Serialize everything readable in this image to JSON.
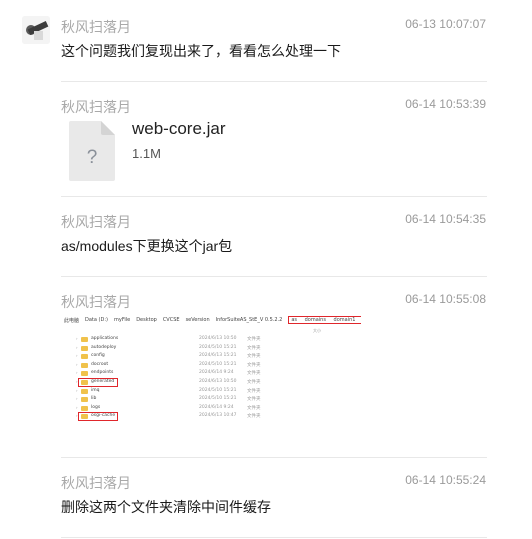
{
  "messages": [
    {
      "sender": "秋风扫落月",
      "time": "06-13 10:07:07",
      "text": "这个问题我们复现出来了，看看怎么处理一下"
    },
    {
      "sender": "秋风扫落月",
      "time": "06-14 10:53:39",
      "file": {
        "name": "web-core.jar",
        "size": "1.1M",
        "icon": "unknown-file-icon",
        "glyph": "?"
      }
    },
    {
      "sender": "秋风扫落月",
      "time": "06-14 10:54:35",
      "text": "as/modules下更换这个jar包"
    },
    {
      "sender": "秋风扫落月",
      "time": "06-14 10:55:08",
      "image": {
        "breadcrumbs": [
          "此电脑",
          "Data (D:)",
          "myFile",
          "Desktop",
          "CVCSE",
          "seVersion",
          "InforSuiteAS_StE_V 0.5.2.2"
        ],
        "highlighted_path": [
          "as",
          "domains",
          "domain1"
        ],
        "col_hint": "大小",
        "rows": [
          {
            "name": "applications",
            "date": "2024/6/13 10:50",
            "type": "文件夹",
            "highlight": false
          },
          {
            "name": "autodeploy",
            "date": "2024/5/10 15:21",
            "type": "文件夹",
            "highlight": false
          },
          {
            "name": "config",
            "date": "2024/6/13 15:21",
            "type": "文件夹",
            "highlight": false
          },
          {
            "name": "docroot",
            "date": "2024/5/10 15:21",
            "type": "文件夹",
            "highlight": false
          },
          {
            "name": "endpoints",
            "date": "2024/6/14 9:24",
            "type": "文件夹",
            "highlight": false
          },
          {
            "name": "generated",
            "date": "2024/6/13 10:50",
            "type": "文件夹",
            "highlight": true
          },
          {
            "name": "imq",
            "date": "2024/5/10 15:21",
            "type": "文件夹",
            "highlight": false
          },
          {
            "name": "lib",
            "date": "2024/5/10 15:21",
            "type": "文件夹",
            "highlight": false
          },
          {
            "name": "logs",
            "date": "2024/6/14 9:24",
            "type": "文件夹",
            "highlight": false
          },
          {
            "name": "osgi-cache",
            "date": "2024/6/13 10:47",
            "type": "文件夹",
            "highlight": true
          }
        ]
      }
    },
    {
      "sender": "秋风扫落月",
      "time": "06-14 10:55:24",
      "text": "删除这两个文件夹清除中间件缓存"
    }
  ],
  "colors": {
    "sender": "#a9a9a9",
    "time": "#9a9a9a",
    "text": "#1a1a1a",
    "divider": "#e8e8e8",
    "highlight": "#e0262b"
  }
}
